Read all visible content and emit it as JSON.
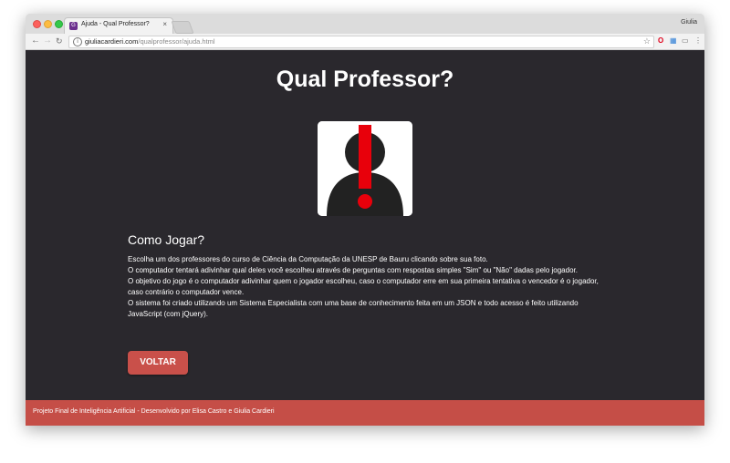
{
  "browser": {
    "tab_title": "Ajuda - Qual Professor?",
    "tab_favicon": "G",
    "tab_close": "×",
    "profile_name": "Giulia",
    "url_host": "giuliacardieri.com",
    "url_path": "/qualprofessor/ajuda.html",
    "icons": {
      "back": "back-arrow-icon",
      "forward": "forward-arrow-icon",
      "reload": "reload-icon",
      "info": "info-icon",
      "bookmark": "star-icon",
      "opera": "opera-icon",
      "extension": "extension-icon",
      "cast": "cast-icon",
      "menu": "menu-icon"
    }
  },
  "page": {
    "title": "Qual Professor?",
    "portrait_icon": "unknown-person-exclamation-icon",
    "section_title": "Como Jogar?",
    "paragraphs": [
      "Escolha um dos professores do curso de Ciência da Computação da UNESP de Bauru clicando sobre sua foto.",
      "O computador tentará adivinhar qual deles você escolheu através de perguntas com respostas simples \"Sim\" ou \"Não\" dadas pelo jogador.",
      "O objetivo do jogo é o computador adivinhar quem o jogador escolheu, caso o computador erre em sua primeira tentativa o vencedor é o jogador, caso contrário o computador vence.",
      "O sistema foi criado utilizando um Sistema Especialista com uma base de conhecimento feita em um JSON e todo acesso é feito utilizando JavaScript (com jQuery)."
    ],
    "button_label": "VOLTAR"
  },
  "footer": {
    "text": "Projeto Final de Inteligência Artificial - Desenvolvido por Elisa Castro e Giulia Cardieri"
  },
  "colors": {
    "page_background": "#2a282d",
    "accent": "#c9504a",
    "footer": "#c54e47",
    "exclamation": "#e8000b"
  }
}
